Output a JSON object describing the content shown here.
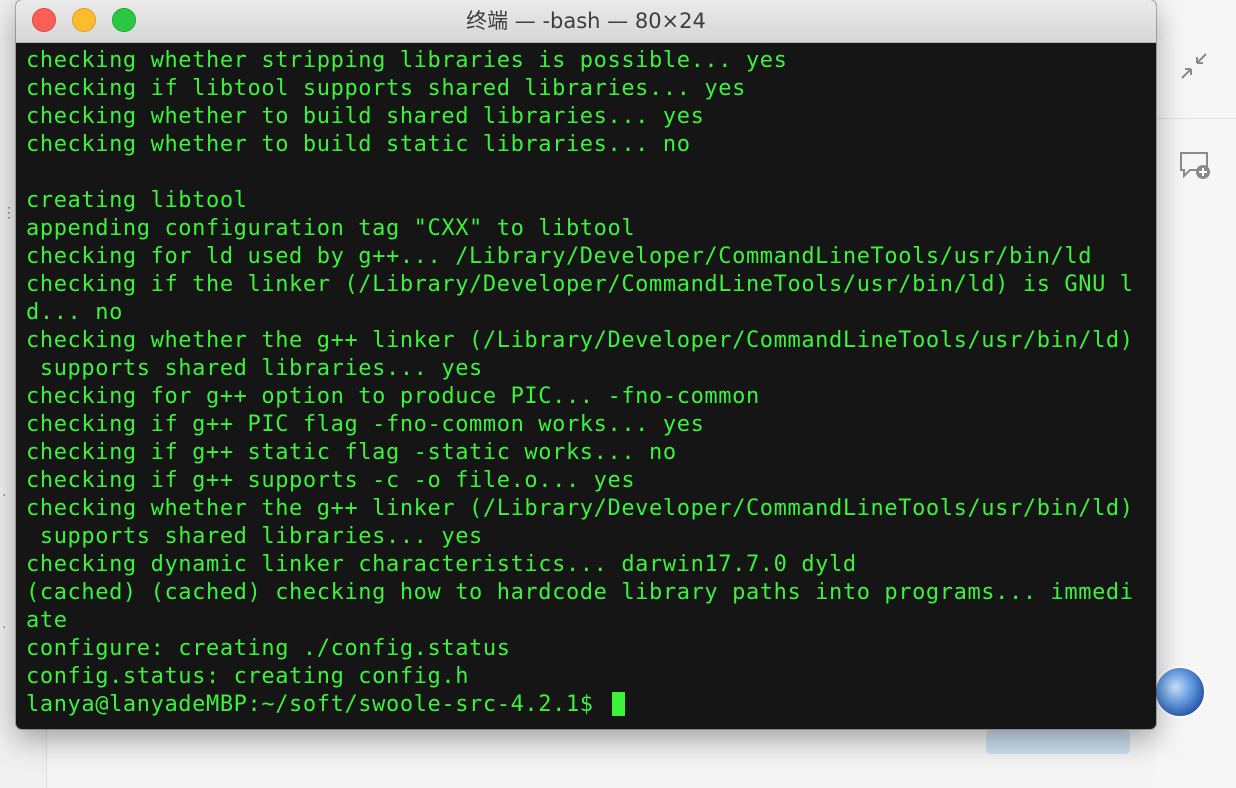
{
  "window": {
    "title": "终端 — -bash — 80×24"
  },
  "terminal": {
    "lines": [
      "checking whether stripping libraries is possible... yes",
      "checking if libtool supports shared libraries... yes",
      "checking whether to build shared libraries... yes",
      "checking whether to build static libraries... no",
      "",
      "creating libtool",
      "appending configuration tag \"CXX\" to libtool",
      "checking for ld used by g++... /Library/Developer/CommandLineTools/usr/bin/ld",
      "checking if the linker (/Library/Developer/CommandLineTools/usr/bin/ld) is GNU l",
      "d... no",
      "checking whether the g++ linker (/Library/Developer/CommandLineTools/usr/bin/ld)",
      " supports shared libraries... yes",
      "checking for g++ option to produce PIC... -fno-common",
      "checking if g++ PIC flag -fno-common works... yes",
      "checking if g++ static flag -static works... no",
      "checking if g++ supports -c -o file.o... yes",
      "checking whether the g++ linker (/Library/Developer/CommandLineTools/usr/bin/ld)",
      " supports shared libraries... yes",
      "checking dynamic linker characteristics... darwin17.7.0 dyld",
      "(cached) (cached) checking how to hardcode library paths into programs... immedi",
      "ate",
      "configure: creating ./config.status",
      "config.status: creating config.h"
    ],
    "prompt": "lanya@lanyadeMBP:~/soft/swoole-src-4.2.1$ "
  },
  "colors": {
    "terminal_bg": "#151515",
    "terminal_text": "#3cf23c",
    "close": "#fc5f57",
    "minimize": "#fdbc2e",
    "zoom": "#29c840"
  },
  "icons": {
    "close": "close-icon",
    "minimize": "minimize-icon",
    "zoom": "zoom-icon",
    "collapse": "collapse-arrows-icon",
    "new_comment": "add-comment-icon"
  }
}
